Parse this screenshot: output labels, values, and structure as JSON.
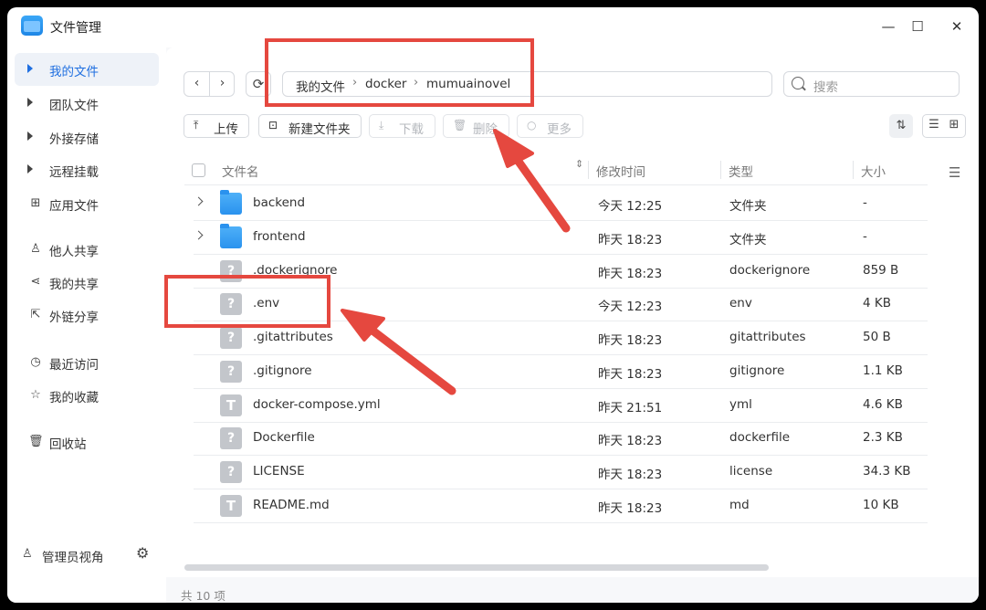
{
  "app": {
    "title": "文件管理"
  },
  "window_controls": {
    "minimize": "—",
    "maximize": "☐",
    "close": "✕"
  },
  "sidebar": {
    "items": [
      {
        "label": "我的文件",
        "icon": "caret-icon",
        "active": true
      },
      {
        "label": "团队文件",
        "icon": "caret-icon"
      },
      {
        "label": "外接存储",
        "icon": "caret-icon"
      },
      {
        "label": "远程挂载",
        "icon": "caret-icon"
      },
      {
        "label": "应用文件",
        "icon": "grid-icon"
      },
      {
        "label": "他人共享",
        "icon": "users-icon"
      },
      {
        "label": "我的共享",
        "icon": "share-icon"
      },
      {
        "label": "外链分享",
        "icon": "external-link-icon"
      },
      {
        "label": "最近访问",
        "icon": "clock-icon"
      },
      {
        "label": "我的收藏",
        "icon": "star-icon"
      },
      {
        "label": "回收站",
        "icon": "trash-icon"
      }
    ],
    "footer": {
      "label": "管理员视角",
      "icon": "admin-icon",
      "settings_icon": "gear-icon"
    }
  },
  "breadcrumb": [
    "我的文件",
    "docker",
    "mumuainovel"
  ],
  "search": {
    "placeholder": "搜索"
  },
  "toolbar": {
    "upload": "上传",
    "new_folder": "新建文件夹",
    "download": "下载",
    "delete": "删除",
    "more": "更多"
  },
  "table": {
    "columns": [
      "文件名",
      "修改时间",
      "类型",
      "大小"
    ],
    "rows": [
      {
        "name": "backend",
        "modified": "今天 12:25",
        "type": "文件夹",
        "size": "-",
        "kind": "folder"
      },
      {
        "name": "frontend",
        "modified": "昨天 18:23",
        "type": "文件夹",
        "size": "-",
        "kind": "folder"
      },
      {
        "name": ".dockerignore",
        "modified": "昨天 18:23",
        "type": "dockerignore",
        "size": "859 B",
        "kind": "unknown"
      },
      {
        "name": ".env",
        "modified": "今天 12:23",
        "type": "env",
        "size": "4 KB",
        "kind": "unknown"
      },
      {
        "name": ".gitattributes",
        "modified": "昨天 18:23",
        "type": "gitattributes",
        "size": "50 B",
        "kind": "unknown"
      },
      {
        "name": ".gitignore",
        "modified": "昨天 18:23",
        "type": "gitignore",
        "size": "1.1 KB",
        "kind": "unknown"
      },
      {
        "name": "docker-compose.yml",
        "modified": "昨天 21:51",
        "type": "yml",
        "size": "4.6 KB",
        "kind": "text"
      },
      {
        "name": "Dockerfile",
        "modified": "昨天 18:23",
        "type": "dockerfile",
        "size": "2.3 KB",
        "kind": "unknown"
      },
      {
        "name": "LICENSE",
        "modified": "昨天 18:23",
        "type": "license",
        "size": "34.3 KB",
        "kind": "unknown"
      },
      {
        "name": "README.md",
        "modified": "昨天 18:23",
        "type": "md",
        "size": "10 KB",
        "kind": "text"
      }
    ]
  },
  "status": {
    "count": "共 10 项"
  },
  "colors": {
    "accent": "#1f6fe0",
    "annotation": "#e5483f",
    "folder": "#2a92ee"
  }
}
